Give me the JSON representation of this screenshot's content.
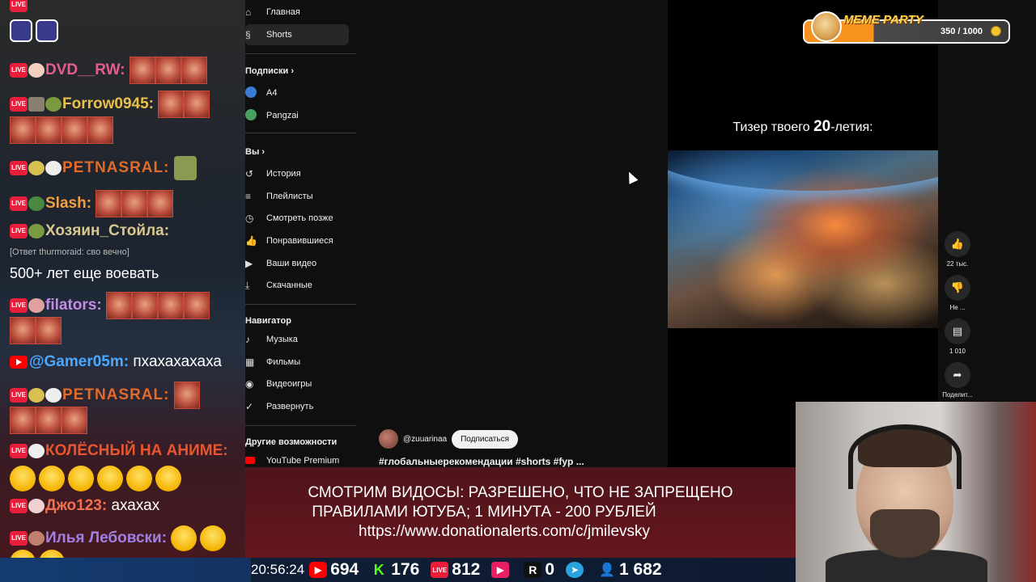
{
  "chat": {
    "badge_text": "LIVE",
    "messages": [
      {
        "user": "DVD__RW:"
      },
      {
        "user": "Forrow0945:"
      },
      {
        "user": "PETNASRAL:"
      },
      {
        "user": "Slash:"
      },
      {
        "user": "Хозяин_Стойла:"
      },
      {
        "reply": "[Ответ thurmoraid: сво вечно]",
        "text": "500+ лет еще воевать"
      },
      {
        "user": "filators:"
      },
      {
        "user": "@Gamer05m:",
        "text": "пхахахахаха"
      },
      {
        "user": "PETNASRAL:"
      },
      {
        "user": "КОЛЁСНЫЙ НА АНИМЕ:"
      },
      {
        "user": "Джо123:",
        "text": "ахахах"
      },
      {
        "user": "Илья Лебовски:"
      }
    ],
    "colors": {
      "dvd": "#e55d8f",
      "forrow": "#e8c04a",
      "petnasral": "#e06b2a",
      "slash": "#f0a040",
      "hozyain": "#d8c890",
      "filators": "#c68ae6",
      "gamer": "#4aa8ff",
      "kolesny": "#e8552e",
      "djo": "#f07050",
      "ilya": "#a080e0"
    }
  },
  "sidebar": {
    "items_top": [
      {
        "icon": "home-icon",
        "glyph": "⌂",
        "label": "Главная"
      },
      {
        "icon": "shorts-icon",
        "glyph": "§",
        "label": "Shorts"
      }
    ],
    "subs_header": "Подписки",
    "subs": [
      {
        "label": "A4",
        "color": "#3a7bd5"
      },
      {
        "label": "Pangzai",
        "color": "#4aa060"
      }
    ],
    "you_header": "Вы",
    "you_items": [
      {
        "icon": "history-icon",
        "glyph": "↺",
        "label": "История"
      },
      {
        "icon": "playlists-icon",
        "glyph": "≡",
        "label": "Плейлисты"
      },
      {
        "icon": "watch-later-icon",
        "glyph": "◷",
        "label": "Смотреть позже"
      },
      {
        "icon": "liked-icon",
        "glyph": "👍",
        "label": "Понравившиеся"
      },
      {
        "icon": "your-videos-icon",
        "glyph": "▶",
        "label": "Ваши видео"
      },
      {
        "icon": "downloads-icon",
        "glyph": "⤓",
        "label": "Скачанные"
      }
    ],
    "nav_header": "Навигатор",
    "nav_items": [
      {
        "icon": "music-icon",
        "glyph": "♪",
        "label": "Музыка"
      },
      {
        "icon": "films-icon",
        "glyph": "▦",
        "label": "Фильмы"
      },
      {
        "icon": "games-icon",
        "glyph": "◉",
        "label": "Видеоигры"
      },
      {
        "icon": "expand-icon",
        "glyph": "✓",
        "label": "Развернуть"
      }
    ],
    "other_header": "Другие возможности",
    "premium_label": "YouTube Premium"
  },
  "video": {
    "title_prefix": "Тизер твоего ",
    "title_num": "20",
    "title_suffix": "-летия:",
    "channel": "@zuuarinaa",
    "subscribe_label": "Подписаться",
    "hashtags": "#глобальныерекомендации #shorts #fyp ...",
    "actions": [
      {
        "icon": "like-icon",
        "glyph": "👍",
        "label": "22 тыс."
      },
      {
        "icon": "dislike-icon",
        "glyph": "👎",
        "label": "Не ..."
      },
      {
        "icon": "comments-icon",
        "glyph": "▤",
        "label": "1 010"
      },
      {
        "icon": "share-icon",
        "glyph": "➦",
        "label": "Поделит..."
      }
    ]
  },
  "meme_party": {
    "title": "MEME PARTY",
    "progress_text": "350 / 1000",
    "progress": 0.35
  },
  "donation": {
    "line1": "СМОТРИМ ВИДОСЫ: РАЗРЕШЕНО, ЧТО НЕ ЗАПРЕЩЕНО",
    "line2": "ПРАВИЛАМИ ЮТУБА; 1 МИНУТА - 200 РУБЛЕЙ",
    "line3": "https://www.donationalerts.com/c/jmilevsky"
  },
  "stats": {
    "time": "20:56:24",
    "youtube": "694",
    "kick": "176",
    "live": "812",
    "vk": "",
    "rutube": "0",
    "telegram": "",
    "total": "1 682"
  }
}
